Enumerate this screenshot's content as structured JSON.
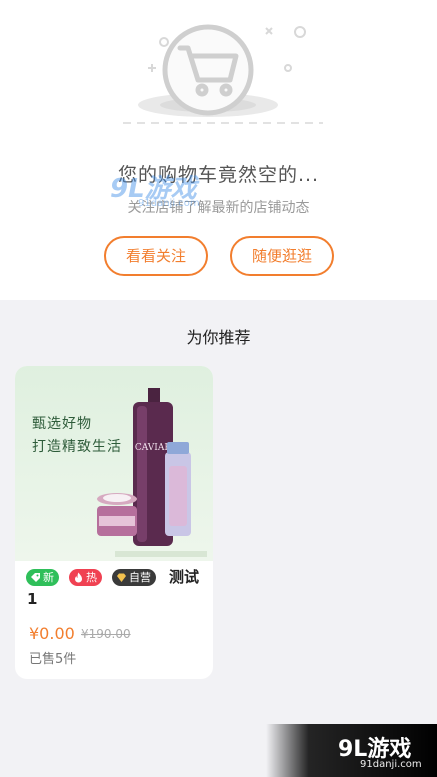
{
  "empty_state": {
    "title": "您的购物车竟然空的...",
    "subtitle": "关注店铺了解最新的店铺动态",
    "follow_button": "看看关注",
    "browse_button": "随便逛逛"
  },
  "recommend": {
    "title": "为你推荐",
    "products": [
      {
        "image_text_line1": "甄选好物",
        "image_text_line2": "打造精致生活",
        "tags": [
          "新",
          "热",
          "自营"
        ],
        "name_line1": "测试",
        "name_line2": "1",
        "price": "¥0.00",
        "original_price": "¥190.00",
        "sold": "已售5件"
      }
    ]
  },
  "watermark": {
    "logo": "9L游戏",
    "logo_small": "91danji.com",
    "url": "91danji.com"
  },
  "colors": {
    "accent": "#f27e2e",
    "tag_new": "#2fbf5a",
    "tag_hot": "#f04152",
    "tag_self": "#3a3a3a"
  },
  "icons": [
    "shopping-cart-icon",
    "tag-icon",
    "fire-icon",
    "diamond-icon"
  ]
}
